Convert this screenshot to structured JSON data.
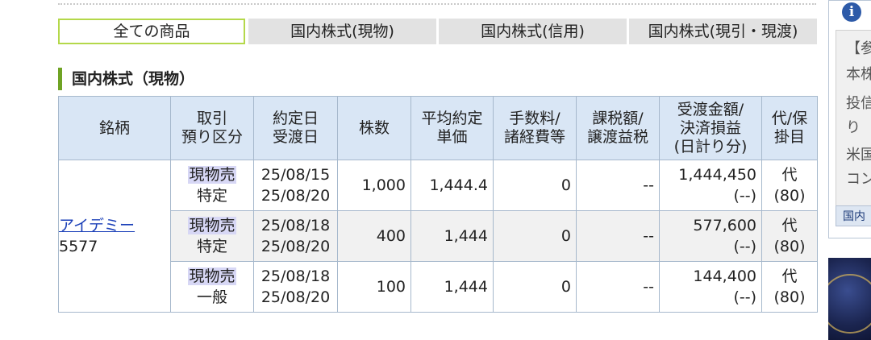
{
  "tabs": [
    {
      "label": "全ての商品",
      "active": true
    },
    {
      "label": "国内株式(現物)",
      "active": false
    },
    {
      "label": "国内株式(信用)",
      "active": false
    },
    {
      "label": "国内株式(現引・現渡)",
      "active": false
    }
  ],
  "section_title": "国内株式（現物）",
  "table": {
    "headers": [
      [
        "銘柄"
      ],
      [
        "取引",
        "預り区分"
      ],
      [
        "約定日",
        "受渡日"
      ],
      [
        "株数"
      ],
      [
        "平均約定",
        "単価"
      ],
      [
        "手数料/",
        "諸経費等"
      ],
      [
        "課税額/",
        "譲渡益税"
      ],
      [
        "受渡金額/",
        "決済損益",
        "(日計り分)"
      ],
      [
        "代/保",
        "掛目"
      ]
    ],
    "stock": {
      "name": "アイデミー",
      "code": "5577"
    },
    "rows": [
      {
        "type": "現物売",
        "account": "特定",
        "trade_date": "25/08/15",
        "settle_date": "25/08/20",
        "shares": "1,000",
        "price": "1,444.4",
        "fee": "0",
        "tax": "--",
        "amount": "1,444,450",
        "pl": "(--)",
        "collateral": "代",
        "ratio": "(80)"
      },
      {
        "type": "現物売",
        "account": "特定",
        "trade_date": "25/08/18",
        "settle_date": "25/08/20",
        "shares": "400",
        "price": "1,444",
        "fee": "0",
        "tax": "--",
        "amount": "577,600",
        "pl": "(--)",
        "collateral": "代",
        "ratio": "(80)"
      },
      {
        "type": "現物売",
        "account": "一般",
        "trade_date": "25/08/18",
        "settle_date": "25/08/20",
        "shares": "100",
        "price": "1,444",
        "fee": "0",
        "tax": "--",
        "amount": "144,400",
        "pl": "(--)",
        "collateral": "代",
        "ratio": "(80)"
      }
    ]
  },
  "side": {
    "icon": "i",
    "lines": [
      "【参",
      "本株",
      "投信",
      "り",
      "米国",
      "コン"
    ],
    "button_label": "国内"
  },
  "colors": {
    "header_bg": "#d9e6f5",
    "active_tab_border": "#b4d84a",
    "section_bar": "#6fa324",
    "link": "#1a3fb8",
    "tag_bg": "#d7d7f5"
  }
}
